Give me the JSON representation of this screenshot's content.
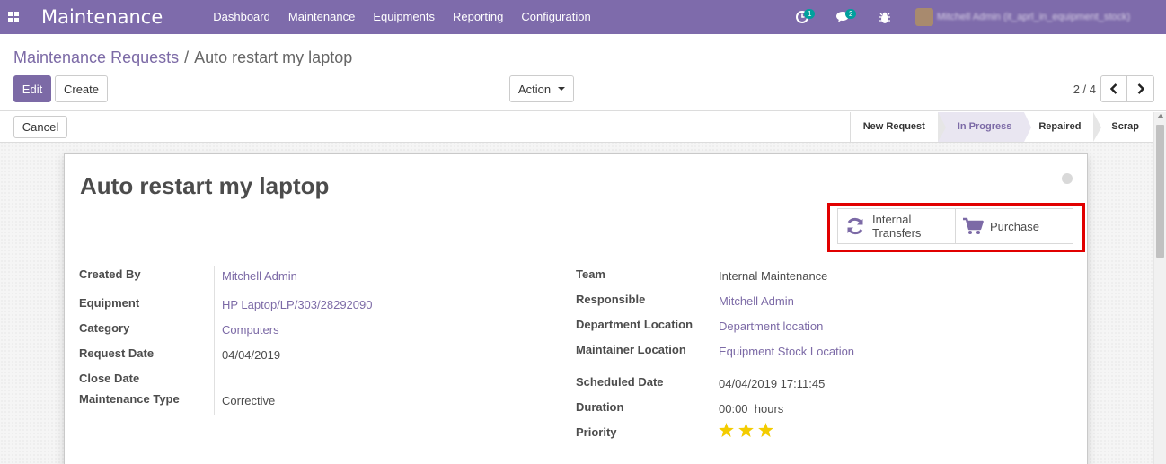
{
  "navbar": {
    "brand": "Maintenance",
    "menu": [
      "Dashboard",
      "Maintenance",
      "Equipments",
      "Reporting",
      "Configuration"
    ],
    "activity_count": "1",
    "message_count": "2",
    "username": "Mitchell Admin (it_aprl_in_equipment_stock)"
  },
  "breadcrumb": {
    "parent": "Maintenance Requests",
    "separator": "/",
    "current": "Auto restart my laptop"
  },
  "buttons": {
    "edit": "Edit",
    "create": "Create",
    "action": "Action",
    "cancel": "Cancel"
  },
  "pager": {
    "value": "2 / 4"
  },
  "stages": [
    {
      "label": "New Request",
      "active": false
    },
    {
      "label": "In Progress",
      "active": true
    },
    {
      "label": "Repaired",
      "active": false
    },
    {
      "label": "Scrap",
      "active": false
    }
  ],
  "record": {
    "title": "Auto restart my laptop"
  },
  "smart_buttons": {
    "internal_transfers_line1": "Internal",
    "internal_transfers_line2": "Transfers",
    "purchase": "Purchase"
  },
  "left_fields": [
    {
      "label": "Created By",
      "value": "Mitchell Admin",
      "link": true
    },
    {
      "label": "Equipment",
      "value": "HP Laptop/LP/303/28292090",
      "link": true
    },
    {
      "label": "Category",
      "value": "Computers",
      "link": true
    },
    {
      "label": "Request Date",
      "value": "04/04/2019",
      "link": false
    },
    {
      "label": "Close Date",
      "value": "",
      "link": false
    },
    {
      "label": "Maintenance Type",
      "value": "Corrective",
      "link": false
    }
  ],
  "right_fields": [
    {
      "label": "Team",
      "value": "Internal Maintenance",
      "link": false
    },
    {
      "label": "Responsible",
      "value": "Mitchell Admin",
      "link": true
    },
    {
      "label": "Department Location",
      "value": "Department location",
      "link": true
    },
    {
      "label": "Maintainer Location",
      "value": "Equipment Stock Location",
      "link": true
    },
    {
      "label": "Scheduled Date",
      "value": "04/04/2019 17:11:45",
      "link": false
    },
    {
      "label": "Duration",
      "value": "00:00  hours",
      "link": false
    },
    {
      "label": "Priority",
      "value": "",
      "link": false
    }
  ],
  "priority_stars": 3,
  "colors": {
    "brand": "#7e6bab",
    "link": "#7c6aa6",
    "highlight": "#e10000",
    "star": "#f3cc00"
  },
  "icons": [
    "apps-icon",
    "activity-clock-icon",
    "chat-icon",
    "bug-icon",
    "chevron-left-icon",
    "chevron-right-icon",
    "refresh-icon",
    "cart-icon",
    "star-icon"
  ]
}
